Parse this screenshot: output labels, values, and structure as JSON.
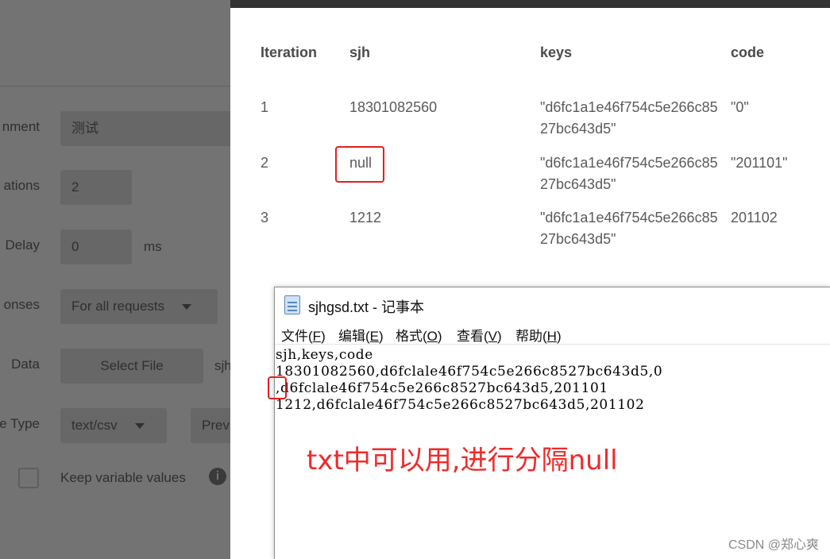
{
  "runner": {
    "divider": true,
    "fields": [
      {
        "label": "nment",
        "value": "测试"
      },
      {
        "label": "ations",
        "value": "2"
      },
      {
        "label": "Delay",
        "value": "0",
        "unit": "ms"
      },
      {
        "label": "onses",
        "value": "For all requests"
      },
      {
        "label": "Data",
        "button": "Select File",
        "trailing": "sjh"
      },
      {
        "label": "e Type",
        "value": "text/csv",
        "trailing": "Prev"
      }
    ],
    "keep_variable_values": "Keep variable values",
    "info_icon": "i"
  },
  "results": {
    "headers": [
      "Iteration",
      "sjh",
      "keys",
      "code"
    ],
    "rows": [
      {
        "iteration": "1",
        "sjh": "18301082560",
        "keys": "\"d6fc1a1e46f754c5e266c8527bc643d5\"",
        "code": "\"0\""
      },
      {
        "iteration": "2",
        "sjh": "null",
        "keys": "\"d6fc1a1e46f754c5e266c8527bc643d5\"",
        "code": "\"201101\""
      },
      {
        "iteration": "3",
        "sjh": "1212",
        "keys": "\"d6fc1a1e46f754c5e266c8527bc643d5\"",
        "code": "201102"
      }
    ]
  },
  "notepad": {
    "title": "sjhgsd.txt - 记事本",
    "menu": [
      {
        "text": "文件(",
        "key": "F",
        "end": ")"
      },
      {
        "text": "编辑(",
        "key": "E",
        "end": ")"
      },
      {
        "text": "格式(",
        "key": "O",
        "end": ")"
      },
      {
        "text": "查看(",
        "key": "V",
        "end": ")"
      },
      {
        "text": "帮助(",
        "key": "H",
        "end": ")"
      }
    ],
    "lines": [
      "sjh,keys,code",
      "18301082560,d6fclale46f754c5e266c8527bc643d5,0",
      ",d6fclale46f754c5e266c8527bc643d5,201101",
      "1212,d6fclale46f754c5e266c8527bc643d5,201102"
    ]
  },
  "annotation": "txt中可以用,进行分隔null",
  "watermark": "CSDN @郑心爽",
  "colors": {
    "highlight": "#e02020",
    "annotation": "#f02a2a"
  }
}
